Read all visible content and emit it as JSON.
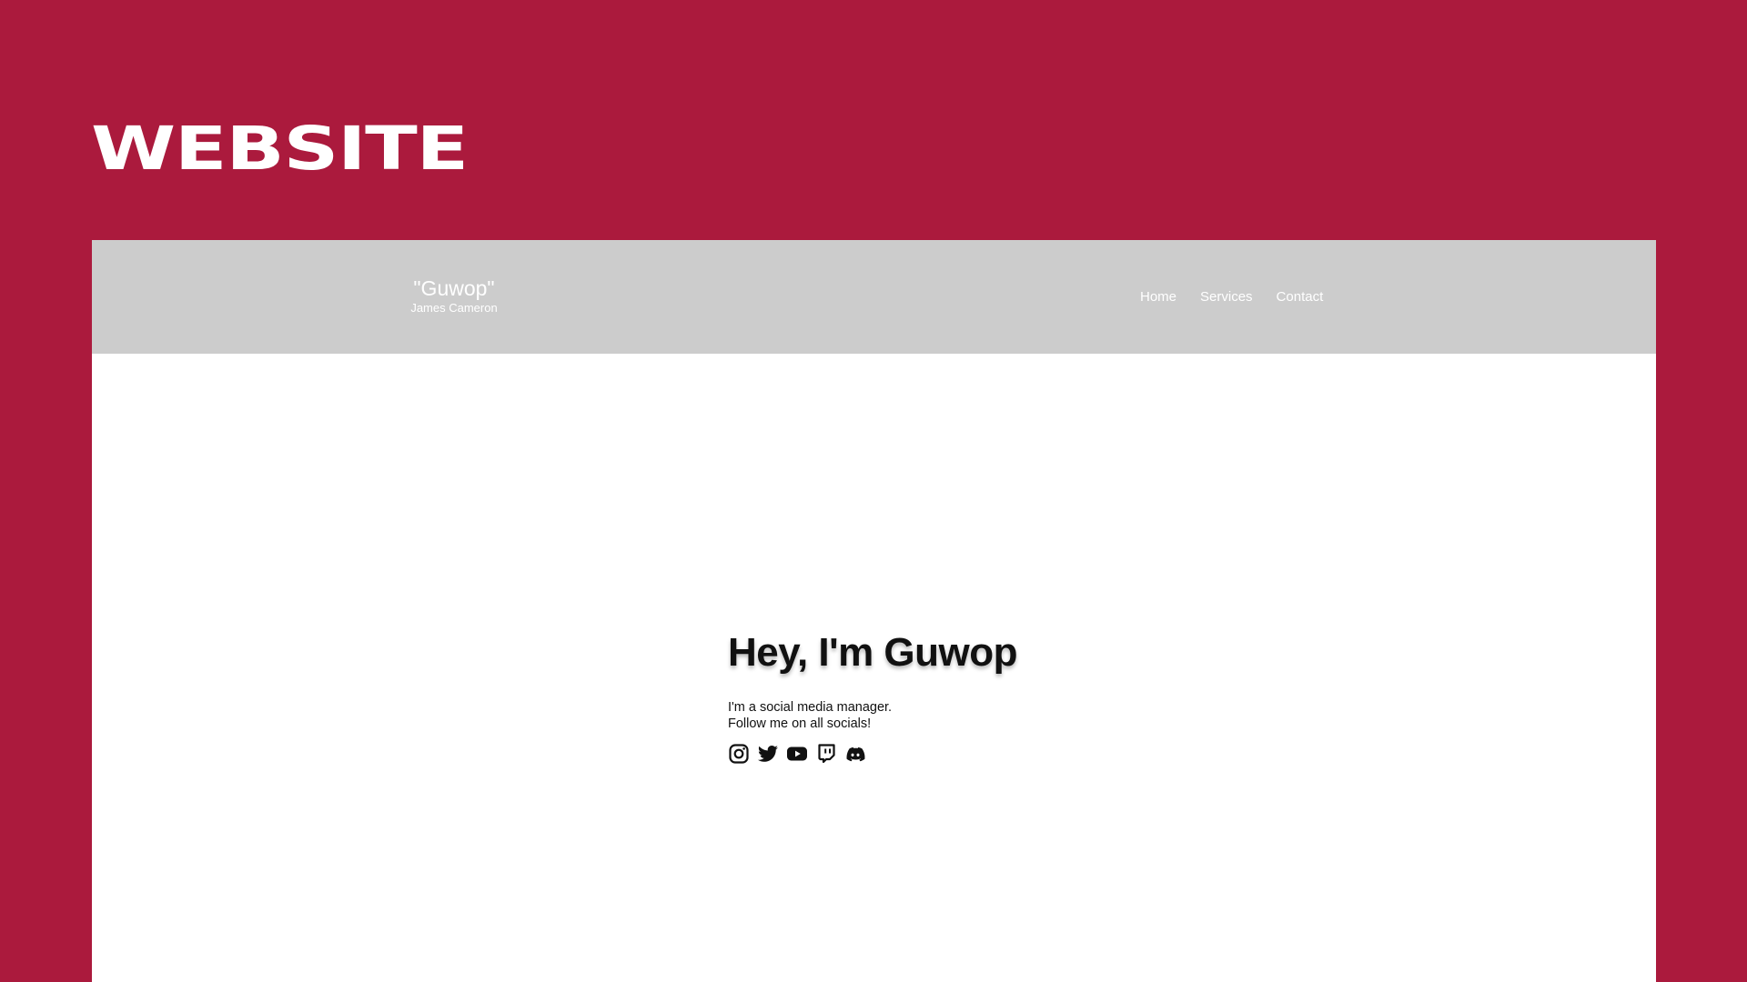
{
  "page": {
    "heading": "WEBSITE",
    "background_color": "#ab1a3d"
  },
  "site": {
    "header": {
      "background_color": "#cccccc",
      "brand": {
        "name": "\"Guwop\"",
        "subtitle": "James Cameron"
      },
      "nav": [
        {
          "label": "Home"
        },
        {
          "label": "Services"
        },
        {
          "label": "Contact"
        }
      ]
    },
    "hero": {
      "title": "Hey, I'm Guwop",
      "line1": "I'm a social media manager.",
      "line2": "Follow me on all socials!",
      "socials": [
        {
          "icon": "instagram-icon"
        },
        {
          "icon": "twitter-icon"
        },
        {
          "icon": "youtube-icon"
        },
        {
          "icon": "twitch-icon"
        },
        {
          "icon": "discord-icon"
        }
      ]
    }
  }
}
